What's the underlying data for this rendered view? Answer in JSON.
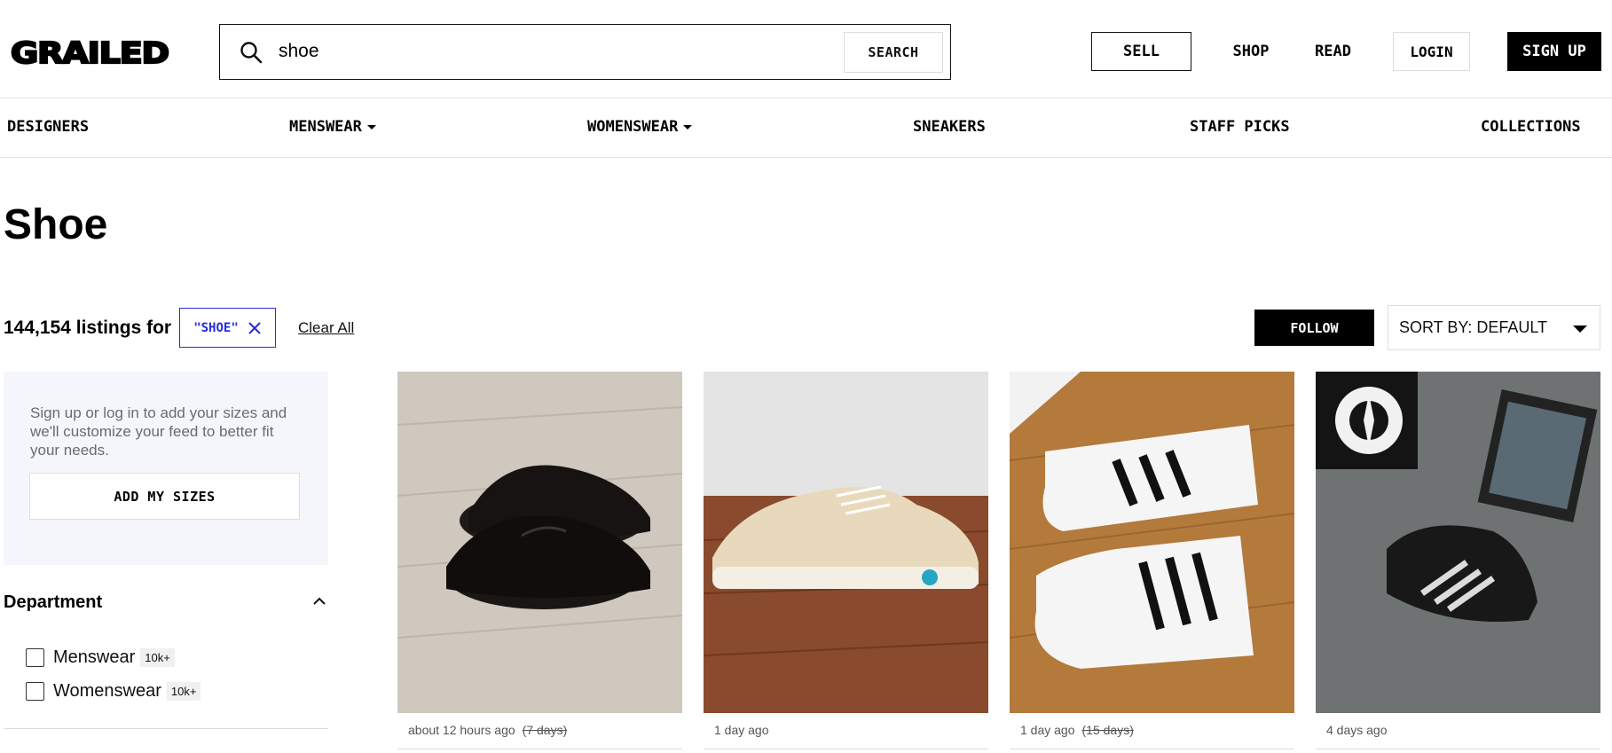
{
  "header": {
    "logo_text": "GRAILED",
    "search": {
      "value": "shoe",
      "button_label": "SEARCH"
    },
    "sell_label": "SELL",
    "shop_label": "SHOP",
    "read_label": "READ",
    "login_label": "LOGIN",
    "signup_label": "SIGN UP"
  },
  "categories": [
    {
      "label": "DESIGNERS",
      "dropdown": false
    },
    {
      "label": "MENSWEAR",
      "dropdown": true
    },
    {
      "label": "WOMENSWEAR",
      "dropdown": true
    },
    {
      "label": "SNEAKERS",
      "dropdown": false
    },
    {
      "label": "STAFF PICKS",
      "dropdown": false
    },
    {
      "label": "COLLECTIONS",
      "dropdown": false
    }
  ],
  "page": {
    "title": "Shoe",
    "listing_count": "144,154 listings for",
    "filter_chip": "\"SHOE\"",
    "clear_all": "Clear All",
    "follow_label": "FOLLOW",
    "sort_label": "SORT BY: DEFAULT"
  },
  "sidebar": {
    "sizes_text": "Sign up or log in to add your sizes and we'll customize your feed to better fit your needs.",
    "add_sizes_label": "ADD MY SIZES",
    "department": {
      "heading": "Department",
      "items": [
        {
          "label": "Menswear",
          "count": "10k+",
          "checked": false
        },
        {
          "label": "Womenswear",
          "count": "10k+",
          "checked": false
        }
      ]
    }
  },
  "listings": [
    {
      "time": "about 12 hours ago",
      "old_time": "(7 days)"
    },
    {
      "time": "1 day ago",
      "old_time": ""
    },
    {
      "time": "1 day ago",
      "old_time": "(15 days)"
    },
    {
      "time": "4 days ago",
      "old_time": ""
    }
  ],
  "colors": {
    "accent_blue": "#2a2adc",
    "black": "#000000",
    "sidebar_bg": "#f5f6fc",
    "border": "#dddddd"
  }
}
